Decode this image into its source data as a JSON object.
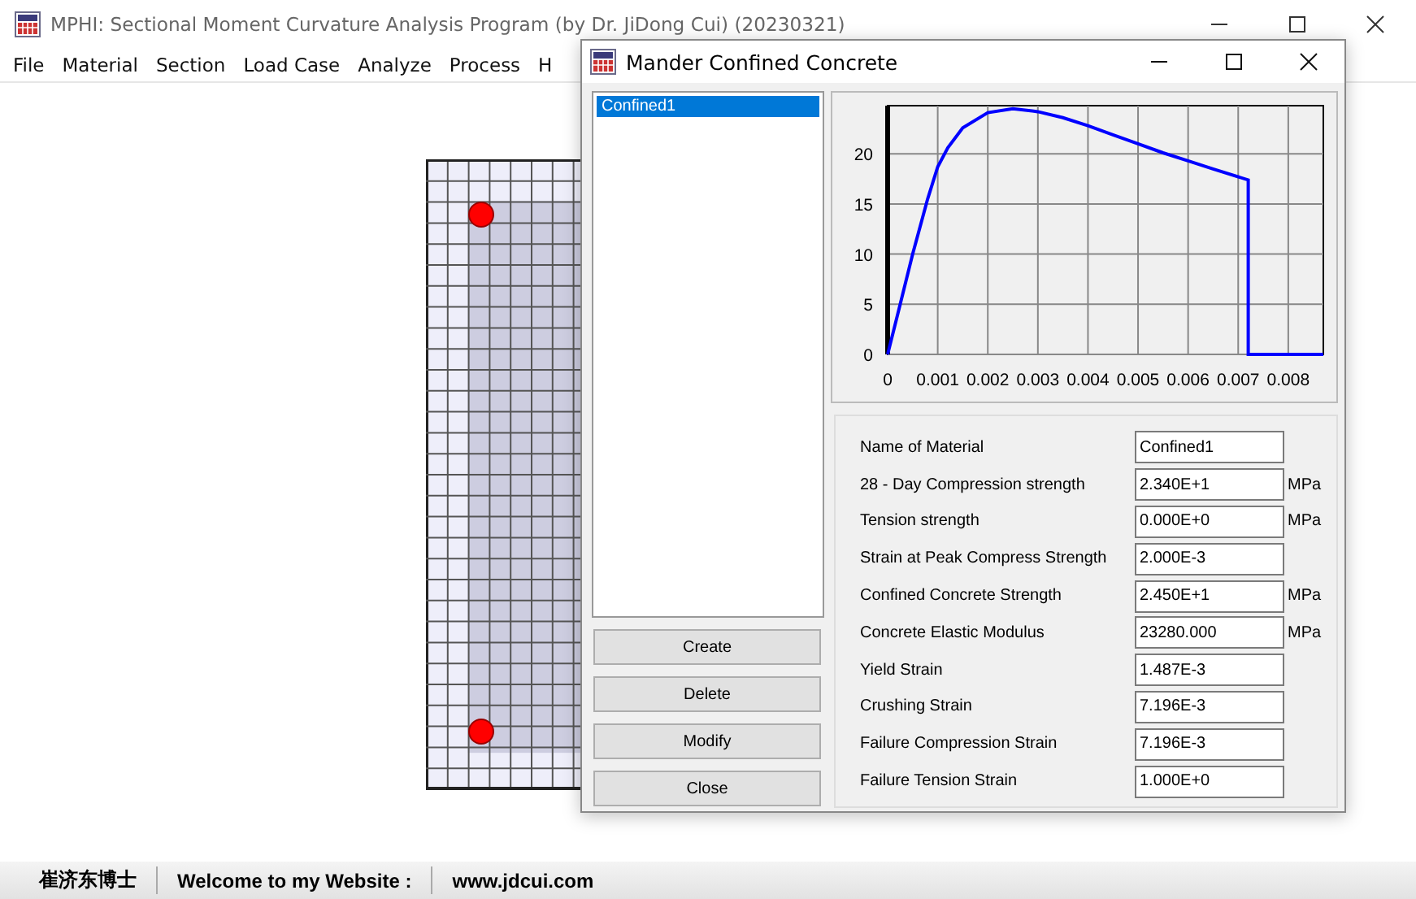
{
  "window": {
    "title": "MPHI: Sectional Moment Curvature Analysis Program (by Dr. JiDong Cui) (20230321)"
  },
  "menu": [
    "File",
    "Material",
    "Section",
    "Load Case",
    "Analyze",
    "Process",
    "H"
  ],
  "dialog": {
    "title": "Mander Confined Concrete",
    "materials": [
      {
        "label": "Confined1",
        "selected": true
      }
    ],
    "buttons": [
      "Create",
      "Delete",
      "Modify",
      "Close"
    ],
    "chart_data": {
      "type": "line",
      "grid": true,
      "xlim": [
        0,
        0.0087
      ],
      "ylim": [
        0,
        24.8
      ],
      "xticks": [
        {
          "value": 0,
          "label": "0"
        },
        {
          "value": 0.001,
          "label": "0.001"
        },
        {
          "value": 0.002,
          "label": "0.002"
        },
        {
          "value": 0.003,
          "label": "0.003"
        },
        {
          "value": 0.004,
          "label": "0.004"
        },
        {
          "value": 0.005,
          "label": "0.005"
        },
        {
          "value": 0.006,
          "label": "0.006"
        },
        {
          "value": 0.007,
          "label": "0.007"
        },
        {
          "value": 0.008,
          "label": "0.008"
        }
      ],
      "yticks": [
        0,
        5,
        10,
        15,
        20
      ],
      "x": [
        0,
        0.0002,
        0.0005,
        0.0008,
        0.001,
        0.0012,
        0.0015,
        0.002,
        0.0025,
        0.003,
        0.0035,
        0.004,
        0.0045,
        0.005,
        0.0055,
        0.006,
        0.0065,
        0.0072,
        0.0072,
        0.0087
      ],
      "series": [
        {
          "color": "#0000ff",
          "values": [
            0,
            4,
            10,
            15.5,
            18.7,
            20.6,
            22.6,
            24.1,
            24.5,
            24.2,
            23.6,
            22.8,
            21.9,
            21.0,
            20.1,
            19.3,
            18.5,
            17.4,
            0,
            0
          ]
        }
      ]
    },
    "fields": [
      {
        "label": "Name of Material",
        "value": "Confined1"
      },
      {
        "label": "28 - Day Compression strength",
        "value": "2.340E+1",
        "unit": "MPa"
      },
      {
        "label": "Tension strength",
        "value": "0.000E+0",
        "unit": "MPa"
      },
      {
        "label": "Strain at Peak Compress Strength",
        "value": "2.000E-3"
      },
      {
        "label": "Confined Concrete Strength",
        "value": "2.450E+1",
        "unit": "MPa"
      },
      {
        "label": "Concrete Elastic Modulus",
        "value": "23280.000",
        "unit": "MPa"
      },
      {
        "label": "Yield Strain",
        "value": "1.487E-3"
      },
      {
        "label": "Crushing Strain",
        "value": "7.196E-3"
      },
      {
        "label": "Failure Compression Strain",
        "value": "7.196E-3"
      },
      {
        "label": "Failure Tension Strain",
        "value": "1.000E+0"
      }
    ]
  },
  "status_bar": [
    "崔济东博士",
    "Welcome to my Website :",
    "www.jdcui.com"
  ]
}
